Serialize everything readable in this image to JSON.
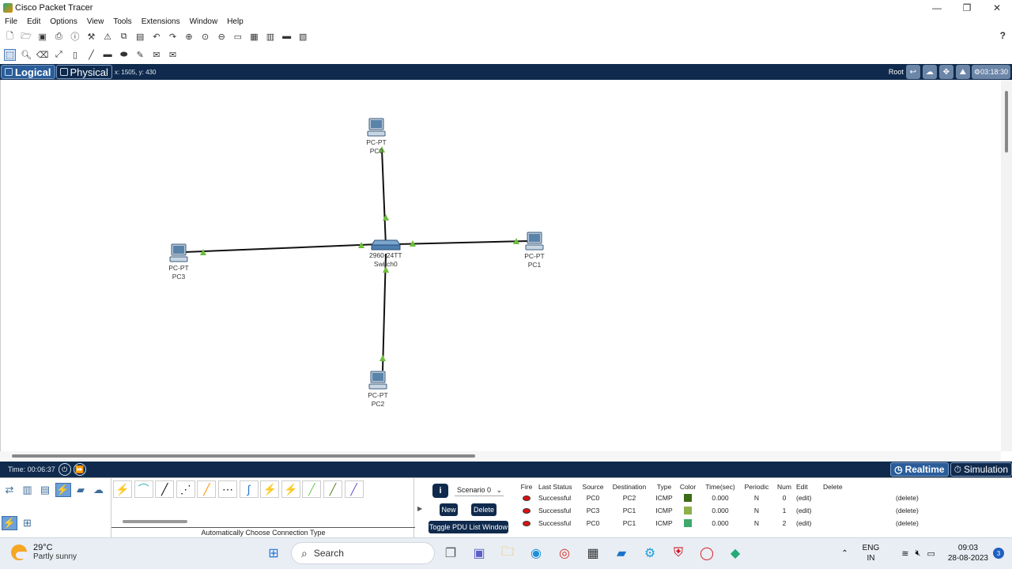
{
  "window": {
    "title": "Cisco Packet Tracer",
    "controls": [
      "—",
      "❐",
      "✕"
    ]
  },
  "menu": [
    "File",
    "Edit",
    "Options",
    "View",
    "Tools",
    "Extensions",
    "Window",
    "Help"
  ],
  "toolbar_main": {
    "icons": [
      "new-icon",
      "open-icon",
      "save-icon",
      "print-icon",
      "info-icon",
      "wizard-icon",
      "network-info-icon",
      "copy-icon",
      "paste-icon",
      "undo-icon",
      "redo-icon",
      "zoom-in-icon",
      "zoom-reset-icon",
      "zoom-out-icon",
      "drawing-palette-icon",
      "custom-device-icon",
      "viewport-icon",
      "cluster-icon",
      "image-icon"
    ],
    "help": "?"
  },
  "toolbar_tools": {
    "icons": [
      "select-icon",
      "inspect-icon",
      "delete-icon",
      "resize-icon",
      "note-icon",
      "line-icon",
      "rectangle-icon",
      "ellipse-icon",
      "freeform-icon",
      "simple-pdu-icon",
      "complex-pdu-icon"
    ]
  },
  "modebar": {
    "logical": "Logical",
    "physical": "Physical",
    "coords": "x: 1505, y: 430",
    "root": "Root",
    "time": "03:18:30"
  },
  "devices": [
    {
      "id": "pc0",
      "model": "PC-PT",
      "name": "PC0"
    },
    {
      "id": "pc1",
      "model": "PC-PT",
      "name": "PC1"
    },
    {
      "id": "pc2",
      "model": "PC-PT",
      "name": "PC2"
    },
    {
      "id": "pc3",
      "model": "PC-PT",
      "name": "PC3"
    },
    {
      "id": "switch0",
      "model": "2960-24TT",
      "name": "Switch0"
    }
  ],
  "timebar": {
    "time": "Time: 00:06:37",
    "realtime": "Realtime",
    "simulation": "Simulation"
  },
  "connections": {
    "label": "Automatically Choose Connection Type"
  },
  "scenario": {
    "info": "i",
    "select": "Scenario 0",
    "new": "New",
    "delete": "Delete",
    "toggle": "Toggle PDU List Window"
  },
  "pdu_table": {
    "headers": [
      "Fire",
      "Last Status",
      "Source",
      "Destination",
      "Type",
      "Color",
      "Time(sec)",
      "Periodic",
      "Num",
      "Edit",
      "Delete"
    ],
    "rows": [
      {
        "status": "Successful",
        "source": "PC0",
        "destination": "PC2",
        "type": "ICMP",
        "color": "#3d6b16",
        "time": "0.000",
        "periodic": "N",
        "num": "0",
        "edit": "(edit)",
        "delete": "(delete)"
      },
      {
        "status": "Successful",
        "source": "PC3",
        "destination": "PC1",
        "type": "ICMP",
        "color": "#8db04a",
        "time": "0.000",
        "periodic": "N",
        "num": "1",
        "edit": "(edit)",
        "delete": "(delete)"
      },
      {
        "status": "Successful",
        "source": "PC0",
        "destination": "PC1",
        "type": "ICMP",
        "color": "#3fa86a",
        "time": "0.000",
        "periodic": "N",
        "num": "2",
        "edit": "(edit)",
        "delete": "(delete)"
      }
    ]
  },
  "taskbar": {
    "temp": "29°C",
    "weather": "Partly sunny",
    "search": "Search",
    "lang1": "ENG",
    "lang2": "IN",
    "time": "09:03",
    "date": "28-08-2023",
    "notifications": "3"
  },
  "colors": {
    "navy": "#0f2a4d",
    "link_green": "#6cbf3a"
  }
}
